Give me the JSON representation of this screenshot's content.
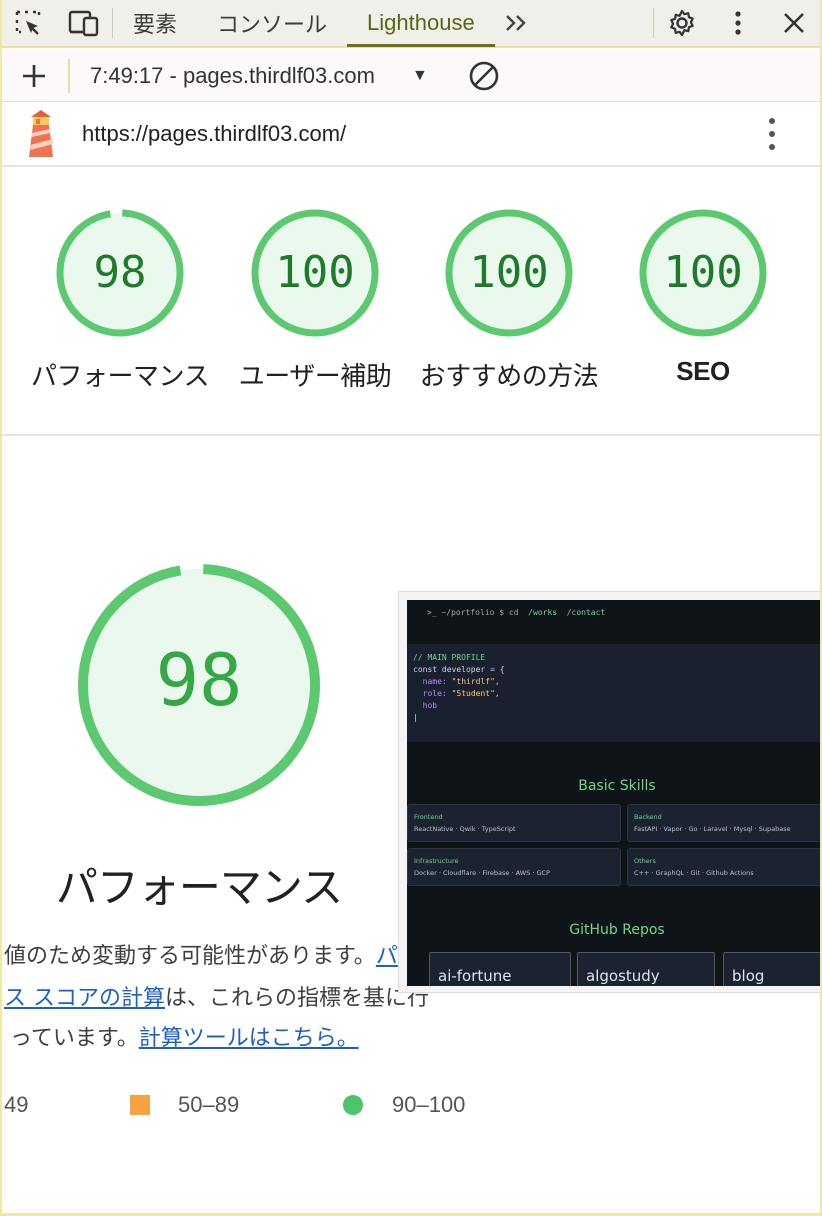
{
  "devtools": {
    "tabs": [
      {
        "label": "要素"
      },
      {
        "label": "コンソール"
      },
      {
        "label": "Lighthouse"
      }
    ]
  },
  "toolbar": {
    "report_label": "7:49:17 - pages.thirdlf03.com"
  },
  "report": {
    "url": "https://pages.thirdlf03.com/"
  },
  "gauges": [
    {
      "score": "98",
      "label": "パフォーマンス"
    },
    {
      "score": "100",
      "label": "ユーザー補助"
    },
    {
      "score": "100",
      "label": "おすすめの方法"
    },
    {
      "score": "100",
      "label": "SEO"
    }
  ],
  "performance": {
    "score": "98",
    "title": "パフォーマンス",
    "desc_line1_prefix": "値のため変動する可能性があります。",
    "desc_line1_link": "パ",
    "desc_line2_link": "ス スコアの計算",
    "desc_line2_suffix": "は、これらの指標を基に行",
    "desc_line3_prefix": "っています。",
    "desc_line3_link": "計算ツールはこちら。"
  },
  "legend": {
    "fail_range": "49",
    "average_range": "50–89",
    "pass_range": "90–100"
  },
  "thumbnail": {
    "nav_prompt": "~/portfolio $ cd",
    "nav_links": [
      "/works",
      "/contact"
    ],
    "code_comment": "// MAIN PROFILE",
    "code_line1": "const developer = {",
    "code_name_key": "name:",
    "code_name_val": "\"thirdlf\",",
    "code_role_key": "role:",
    "code_role_val": "\"Student\",",
    "code_hob": "hob",
    "skills_heading": "Basic Skills",
    "skill_cards": [
      {
        "title": "Frontend",
        "items": "ReactNative · Qwik · TypeScript"
      },
      {
        "title": "Backend",
        "items": "FastAPI · Vapor · Go · Laravel · Mysql · Supabase"
      },
      {
        "title": "Infrastructure",
        "items": "Docker · Cloudflare · Firebase · AWS · GCP"
      },
      {
        "title": "Others",
        "items": "C++ · GraphQL · Git · Github Actions"
      }
    ],
    "repos_heading": "GitHub Repos",
    "repos": [
      "ai-fortune",
      "algostudy",
      "blog"
    ]
  },
  "colors": {
    "pass_green": "#5cc971",
    "pass_fill": "#eaf8ee",
    "average_orange": "#f4a340",
    "link_blue": "#1a5fd0",
    "active_tab": "#5b6316"
  }
}
